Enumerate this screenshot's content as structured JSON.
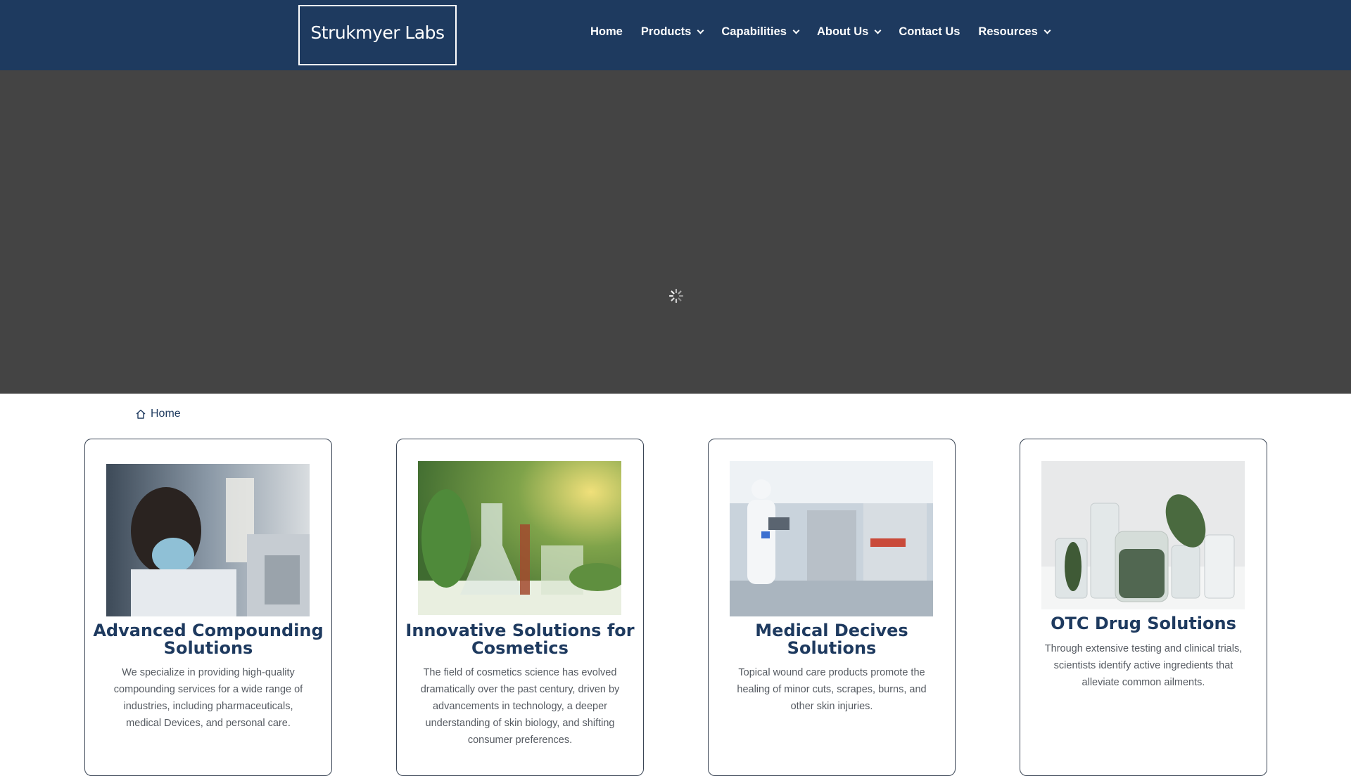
{
  "header": {
    "logo_text": "Strukmyer Labs",
    "nav": [
      {
        "label": "Home",
        "has_dropdown": false
      },
      {
        "label": "Products",
        "has_dropdown": true
      },
      {
        "label": "Capabilities",
        "has_dropdown": true
      },
      {
        "label": "About Us",
        "has_dropdown": true
      },
      {
        "label": "Contact Us",
        "has_dropdown": false
      },
      {
        "label": "Resources",
        "has_dropdown": true
      }
    ]
  },
  "breadcrumb": {
    "home_label": "Home",
    "icon": "home-icon"
  },
  "cards": [
    {
      "title": "Advanced Compounding Solutions",
      "description": "We specialize in providing high-quality compounding services for a wide range of industries, including pharmaceuticals, medical Devices, and personal care."
    },
    {
      "title": "Innovative Solutions for Cosmetics",
      "description": "The field of cosmetics science has evolved dramatically over the past century, driven by advancements in technology, a deeper understanding of skin biology, and shifting consumer preferences."
    },
    {
      "title": "Medical Decives Solutions",
      "description": "Topical wound care products promote the healing of minor cuts, scrapes, burns, and other skin injuries."
    },
    {
      "title": "OTC Drug Solutions",
      "description": "Through extensive testing and clinical trials, scientists identify active ingredients that alleviate common ailments."
    }
  ],
  "colors": {
    "header_bg": "#1e3a5f",
    "hero_bg": "#444444",
    "accent": "#1e3a5f"
  }
}
